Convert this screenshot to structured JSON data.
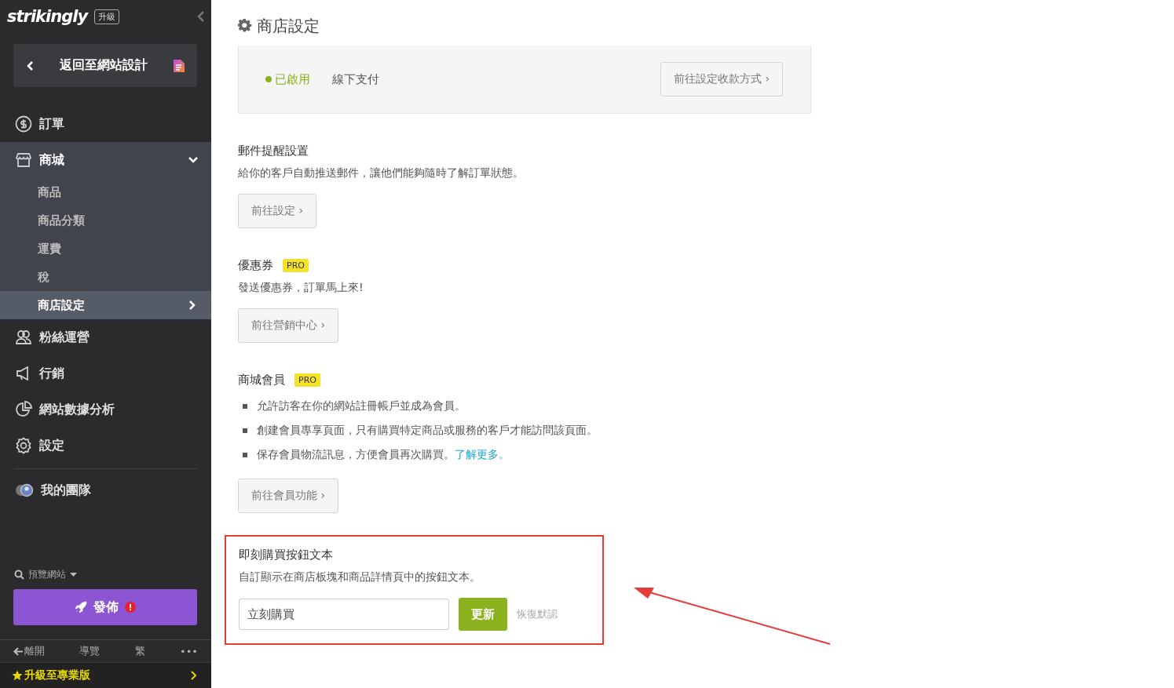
{
  "sidebar": {
    "logo": "strikingly",
    "upgrade_badge": "升級",
    "back_button": "返回至網站設計",
    "nav": [
      {
        "label": "訂單",
        "selected": false
      },
      {
        "label": "商城",
        "expanded": true,
        "selected": false,
        "children": [
          {
            "label": "商品",
            "selected": false
          },
          {
            "label": "商品分類",
            "selected": false
          },
          {
            "label": "運費",
            "selected": false
          },
          {
            "label": "稅",
            "selected": false
          },
          {
            "label": "商店設定",
            "selected": true
          }
        ]
      },
      {
        "label": "粉絲運營",
        "selected": false
      },
      {
        "label": "行銷",
        "selected": false
      },
      {
        "label": "網站數據分析",
        "selected": false
      },
      {
        "label": "設定",
        "selected": false
      }
    ],
    "team": "我的團隊",
    "preview": "預覽網站",
    "publish": "發佈",
    "publish_alert": "!",
    "footer": [
      {
        "label": "離開",
        "kind": "back"
      },
      {
        "label": "導覽",
        "kind": "text"
      },
      {
        "label": "繁",
        "kind": "text"
      },
      {
        "label": "•••",
        "kind": "text"
      }
    ],
    "upgrade": "升級至專業版"
  },
  "page_title": "商店設定",
  "payment": {
    "status": "已啟用",
    "method": "線下支付",
    "button": "前往設定收款方式 ›"
  },
  "sections": [
    {
      "kind": "basic",
      "title": "郵件提醒設置",
      "description": "給你的客戶自動推送郵件，讓他們能夠隨時了解訂單狀態。",
      "button": "前往設定 ›"
    },
    {
      "kind": "basic",
      "title": "優惠券",
      "badge": "PRO",
      "description": "發送優惠券，訂單馬上來!",
      "button": "前往營銷中心 ›"
    },
    {
      "kind": "list",
      "title": "商城會員",
      "badge": "PRO",
      "bullets": [
        "允許訪客在你的網站註冊帳戶並成為會員。",
        "創建會員專享頁面，只有購買特定商品或服務的客戶才能訪問該頁面。",
        "保存會員物流訊息，方便會員再次購買。"
      ],
      "link": "了解更多。",
      "button": "前往會員功能 ›"
    },
    {
      "kind": "input",
      "title": "即刻購買按鈕文本",
      "description": "自訂顯示在商店板塊和商品詳情頁中的按鈕文本。",
      "value": "立刻購買",
      "button": "更新",
      "reset": "恢復默認",
      "highlighted": true
    }
  ]
}
